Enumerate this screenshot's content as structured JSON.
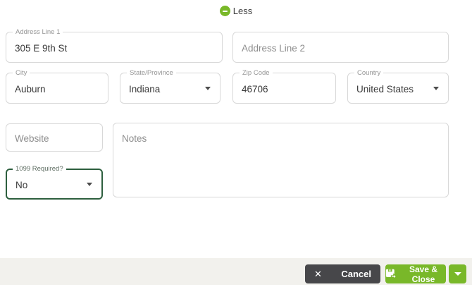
{
  "toggle": {
    "label": "Less",
    "icon": "minus-circle-icon"
  },
  "form": {
    "address_line_1": {
      "label": "Address Line 1",
      "value": "305 E 9th St"
    },
    "address_line_2": {
      "placeholder": "Address Line 2",
      "value": ""
    },
    "city": {
      "label": "City",
      "value": "Auburn"
    },
    "state_province": {
      "label": "State/Province",
      "value": "Indiana",
      "icon": "chevron-down-icon"
    },
    "zip_code": {
      "label": "Zip Code",
      "value": "46706"
    },
    "country": {
      "label": "Country",
      "value": "United States",
      "icon": "chevron-down-icon"
    },
    "website": {
      "placeholder": "Website",
      "value": ""
    },
    "notes": {
      "placeholder": "Notes",
      "value": ""
    },
    "ten99_required": {
      "label": "1099 Required?",
      "value": "No",
      "icon": "chevron-down-icon",
      "focused": true
    }
  },
  "footer": {
    "cancel": {
      "label": "Cancel",
      "icon": "x-icon"
    },
    "save": {
      "label": "Save & Close",
      "icon": "save-icon"
    },
    "save_more": {
      "icon": "chevron-down-icon"
    }
  },
  "colors": {
    "accent_green": "#79b829",
    "focus_border_green": "#2d5f3e",
    "cancel_button_gray": "#47474a",
    "footer_background": "#f2f1ed",
    "field_border": "#d8d8d8",
    "label_gray": "#949494",
    "text_dark": "#3a3a3a"
  }
}
